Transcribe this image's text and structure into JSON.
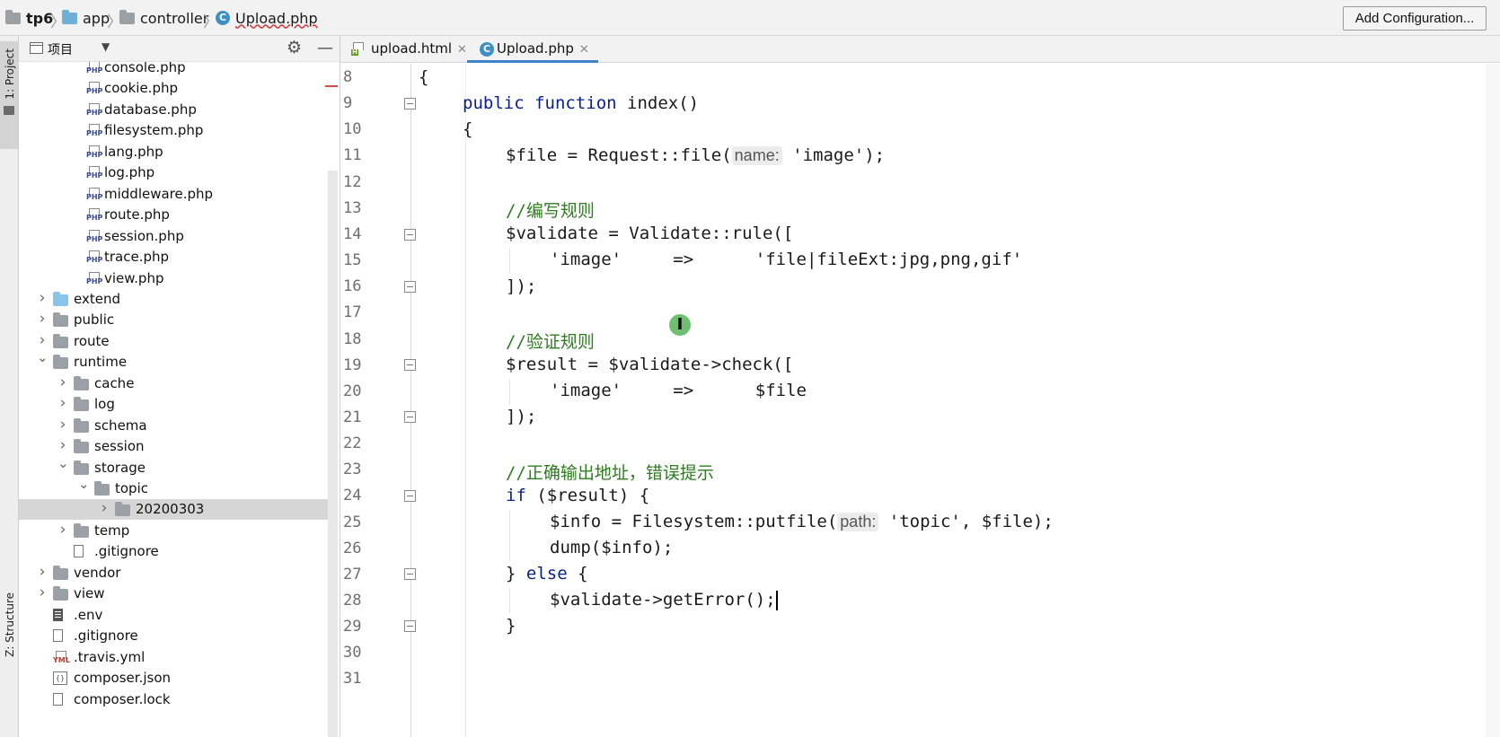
{
  "breadcrumb": {
    "items": [
      "tp6",
      "app",
      "controller",
      "Upload.php"
    ]
  },
  "toolbar": {
    "add_configuration": "Add Configuration..."
  },
  "left_strip": {
    "project_label": "1: Project",
    "structure_label": "Z: Structure"
  },
  "project_panel": {
    "title": "项目",
    "tree": [
      {
        "label": "console.php",
        "type": "php"
      },
      {
        "label": "cookie.php",
        "type": "php"
      },
      {
        "label": "database.php",
        "type": "php"
      },
      {
        "label": "filesystem.php",
        "type": "php"
      },
      {
        "label": "lang.php",
        "type": "php"
      },
      {
        "label": "log.php",
        "type": "php"
      },
      {
        "label": "middleware.php",
        "type": "php"
      },
      {
        "label": "route.php",
        "type": "php"
      },
      {
        "label": "session.php",
        "type": "php"
      },
      {
        "label": "trace.php",
        "type": "php"
      },
      {
        "label": "view.php",
        "type": "php"
      },
      {
        "label": "extend",
        "type": "folder",
        "expanded": false
      },
      {
        "label": "public",
        "type": "folder",
        "expanded": false
      },
      {
        "label": "route",
        "type": "folder",
        "expanded": false
      },
      {
        "label": "runtime",
        "type": "folder",
        "expanded": true
      },
      {
        "label": "cache",
        "type": "folder",
        "expanded": false
      },
      {
        "label": "log",
        "type": "folder",
        "expanded": false
      },
      {
        "label": "schema",
        "type": "folder",
        "expanded": false
      },
      {
        "label": "session",
        "type": "folder",
        "expanded": false
      },
      {
        "label": "storage",
        "type": "folder",
        "expanded": true
      },
      {
        "label": "topic",
        "type": "folder",
        "expanded": true
      },
      {
        "label": "20200303",
        "type": "folder",
        "expanded": false,
        "selected": true
      },
      {
        "label": "temp",
        "type": "folder",
        "expanded": false
      },
      {
        "label": ".gitignore",
        "type": "file"
      },
      {
        "label": "vendor",
        "type": "folder",
        "expanded": false
      },
      {
        "label": "view",
        "type": "folder",
        "expanded": false
      },
      {
        "label": ".env",
        "type": "env"
      },
      {
        "label": ".gitignore",
        "type": "file"
      },
      {
        "label": ".travis.yml",
        "type": "yml"
      },
      {
        "label": "composer.json",
        "type": "json"
      },
      {
        "label": "composer.lock",
        "type": "file"
      }
    ]
  },
  "tabs": [
    {
      "label": "upload.html",
      "active": false
    },
    {
      "label": "Upload.php",
      "active": true
    }
  ],
  "editor": {
    "line_numbers": [
      "8",
      "9",
      "10",
      "11",
      "12",
      "13",
      "14",
      "15",
      "16",
      "17",
      "18",
      "19",
      "20",
      "21",
      "22",
      "23",
      "24",
      "25",
      "26",
      "27",
      "28",
      "29",
      "30",
      "31"
    ],
    "lines": {
      "l8": "{",
      "l9_kw": "public function",
      "l9_rest": " index()",
      "l10": "{",
      "l11_a": "$file = Request::file(",
      "l11_hint": "name:",
      "l11_b": " 'image');",
      "l13": "//编写规则",
      "l14": "$validate = Validate::rule([",
      "l15": "'image'     =>      'file|fileExt:jpg,png,gif'",
      "l16": "]);",
      "l18": "//验证规则",
      "l19": "$result = $validate->check([",
      "l20": "'image'     =>      $file",
      "l21": "]);",
      "l23": "//正确输出地址，错误提示",
      "l24_kw": "if",
      "l24_rest": " ($result) {",
      "l25_a": "$info = Filesystem::putfile(",
      "l25_hint": "path:",
      "l25_b": " 'topic', $file);",
      "l26": "dump($info);",
      "l27_a": "} ",
      "l27_kw": "else",
      "l27_b": " {",
      "l28": "$validate->getError();",
      "l29": "}"
    }
  },
  "colors": {
    "keyword": "#0a1f8f",
    "comment": "#2d7d1e",
    "accent": "#4083c9"
  }
}
